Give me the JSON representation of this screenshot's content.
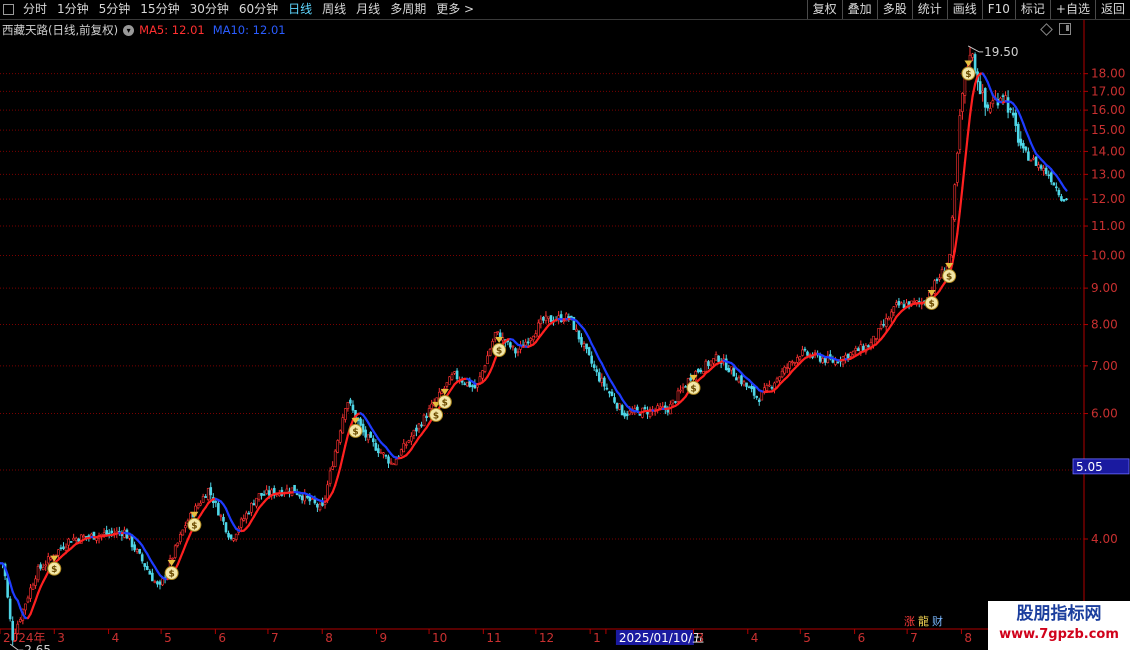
{
  "toolbar": {
    "left_items": [
      {
        "label": "分时"
      },
      {
        "label": "1分钟"
      },
      {
        "label": "5分钟"
      },
      {
        "label": "15分钟"
      },
      {
        "label": "30分钟"
      },
      {
        "label": "60分钟"
      },
      {
        "label": "日线",
        "active": true
      },
      {
        "label": "周线"
      },
      {
        "label": "月线"
      },
      {
        "label": "多周期"
      },
      {
        "label": "更多 >"
      }
    ],
    "right_items": [
      {
        "label": "复权"
      },
      {
        "label": "叠加"
      },
      {
        "label": "多股"
      },
      {
        "label": "统计"
      },
      {
        "label": "画线"
      },
      {
        "label": "F10"
      },
      {
        "label": "标记"
      },
      {
        "label": "+自选"
      },
      {
        "label": "返回"
      }
    ]
  },
  "legend": {
    "stock": "西藏天路(日线,前复权)",
    "ma5": "MA5: 12.01",
    "ma10": "MA10: 12.01"
  },
  "colors": {
    "up": "#ff3232",
    "down": "#4fd7e8",
    "ma5": "#ff2020",
    "ma10": "#1e3cff",
    "grid": "#7a0000",
    "axis": "#b00000"
  },
  "icons": [
    "money-bag-icon"
  ],
  "badges": {
    "zhang": "涨",
    "long": "龍",
    "cai": "财"
  },
  "watermark": {
    "title": "股朋指标网",
    "url": "www.7gpzb.com"
  },
  "chart_data": {
    "type": "candlestick",
    "title": "西藏天路",
    "y_ticks": [
      4.0,
      5.0,
      6.0,
      7.0,
      8.0,
      9.0,
      10.0,
      11.0,
      12.0,
      13.0,
      14.0,
      15.0,
      16.0,
      17.0,
      18.0
    ],
    "ylim": [
      3.0,
      20.2
    ],
    "y_scale": "log",
    "max_label": "19.50",
    "min_label": "2.65",
    "current_price": "5.05",
    "x_labels": [
      "2024年",
      "3",
      "4",
      "5",
      "6",
      "7",
      "8",
      "9",
      "10",
      "11",
      "12",
      "1",
      "2025/01/10/五",
      "3",
      "4",
      "5",
      "6",
      "7",
      "8",
      "9"
    ],
    "close_series": [
      [
        "2024-02-01",
        3.7
      ],
      [
        "2024-02-06",
        2.9
      ],
      [
        "2024-02-20",
        3.6
      ],
      [
        "2024-03-10",
        4.0
      ],
      [
        "2024-04-10",
        4.1
      ],
      [
        "2024-04-30",
        3.4
      ],
      [
        "2024-05-15",
        4.2
      ],
      [
        "2024-05-28",
        4.7
      ],
      [
        "2024-06-10",
        4.0
      ],
      [
        "2024-06-25",
        4.6
      ],
      [
        "2024-07-15",
        4.7
      ],
      [
        "2024-08-01",
        4.4
      ],
      [
        "2024-08-15",
        6.3
      ],
      [
        "2024-08-25",
        5.6
      ],
      [
        "2024-09-10",
        5.1
      ],
      [
        "2024-09-30",
        6.0
      ],
      [
        "2024-10-15",
        6.8
      ],
      [
        "2024-10-28",
        6.5
      ],
      [
        "2024-11-08",
        7.8
      ],
      [
        "2024-11-20",
        7.3
      ],
      [
        "2024-12-05",
        8.1
      ],
      [
        "2024-12-20",
        8.2
      ],
      [
        "2025-01-05",
        6.8
      ],
      [
        "2025-01-20",
        6.0
      ],
      [
        "2025-02-15",
        6.1
      ],
      [
        "2025-02-28",
        6.8
      ],
      [
        "2025-03-15",
        7.2
      ],
      [
        "2025-04-07",
        6.3
      ],
      [
        "2025-05-01",
        7.3
      ],
      [
        "2025-05-20",
        7.1
      ],
      [
        "2025-06-10",
        7.5
      ],
      [
        "2025-06-25",
        8.5
      ],
      [
        "2025-07-10",
        8.6
      ],
      [
        "2025-07-25",
        9.8
      ],
      [
        "2025-08-01",
        16.5
      ],
      [
        "2025-08-06",
        19.5
      ],
      [
        "2025-08-15",
        16.0
      ],
      [
        "2025-08-25",
        17.0
      ],
      [
        "2025-09-05",
        14.0
      ],
      [
        "2025-09-20",
        13.0
      ],
      [
        "2025-09-28",
        12.0
      ]
    ],
    "ma5": 12.01,
    "ma10": 12.01,
    "signal_dates": [
      "2024-03-01",
      "2024-05-07",
      "2024-05-20",
      "2024-08-20",
      "2024-10-05",
      "2024-10-10",
      "2024-11-10",
      "2025-03-01",
      "2025-07-15",
      "2025-07-25",
      "2025-08-05"
    ]
  }
}
